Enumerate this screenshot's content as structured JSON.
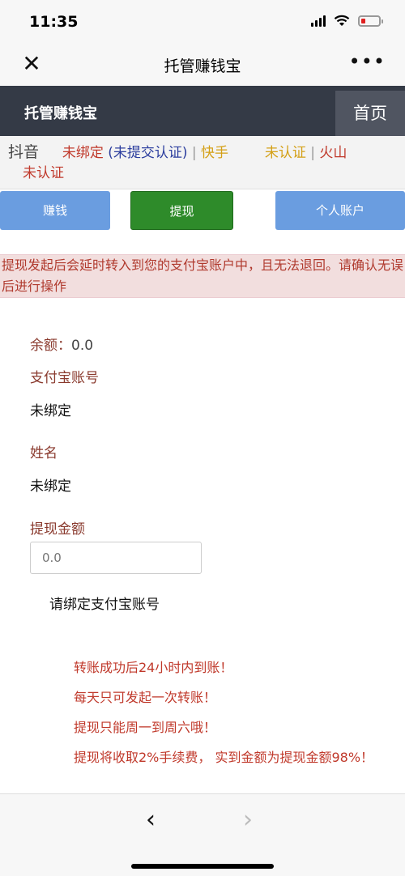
{
  "status": {
    "time": "11:35"
  },
  "nav": {
    "title": "托管赚钱宝",
    "close_icon": "close-icon",
    "more_icon": "more-icon"
  },
  "header": {
    "title": "托管赚钱宝",
    "home": "首页"
  },
  "platforms": {
    "douyin": "抖音",
    "douyin_status": "未绑定",
    "douyin_sub": "(未提交认证)",
    "sep1": "|",
    "kuaishou": "快手",
    "kuaishou_status": "未认证",
    "sep2": "|",
    "huoshan": "火山",
    "huoshan_status": "未认证"
  },
  "tabs": {
    "earn": "赚钱",
    "withdraw": "提现",
    "account": "个人账户"
  },
  "notice": {
    "text": "提现发起后会延时转入到您的支付宝账户中，且无法退回。请确认无误后进行操作"
  },
  "form": {
    "balance_label": "余额：",
    "balance_value": "0.0",
    "alipay_label": "支付宝账号",
    "alipay_value": "未绑定",
    "name_label": "姓名",
    "name_value": "未绑定",
    "amount_label": "提现金额",
    "amount_placeholder": "0.0",
    "bind_message": "请绑定支付宝账号"
  },
  "rules": [
    "转账成功后24小时内到账！",
    "每天只可发起一次转账！",
    "提现只能周一到周六哦！",
    "提现将收取2%手续费， 实到金额为提现金额98%！"
  ],
  "colors": {
    "header_bg": "#343a46",
    "tab_active": "#2e8b2a",
    "tab_inactive": "#6a9de0",
    "notice_bg": "#f2dede",
    "rule_text": "#c0392b"
  }
}
